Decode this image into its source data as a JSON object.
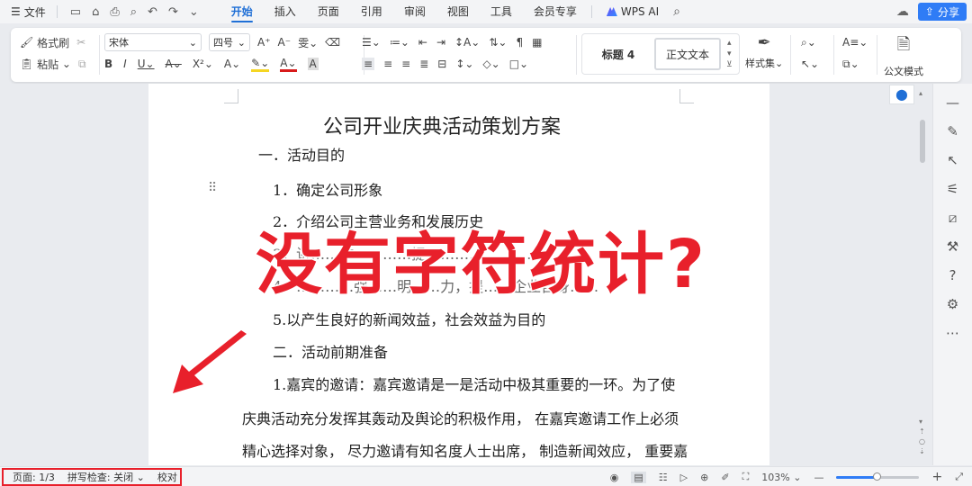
{
  "menubar": {
    "file_label": "文件",
    "tabs": [
      {
        "label": "开始",
        "active": true
      },
      {
        "label": "插入"
      },
      {
        "label": "页面"
      },
      {
        "label": "引用"
      },
      {
        "label": "审阅"
      },
      {
        "label": "视图"
      },
      {
        "label": "工具"
      },
      {
        "label": "会员专享"
      }
    ],
    "wps_ai_label": "WPS AI",
    "share_label": "分享"
  },
  "ribbon": {
    "format_painter": "格式刷",
    "paste": "粘贴",
    "font_name": "宋体",
    "font_size": "四号",
    "styles": {
      "heading4": "标题 4",
      "body_text": "正文文本"
    },
    "style_set": "样式集",
    "official_mode": "公文模式"
  },
  "document": {
    "title": "公司开业庆典活动策划方案",
    "lines": [
      "一．活动目的",
      "1．确定公司形象",
      "2．介绍公司主营业务和发展历史",
      "5.以产生良好的新闻效益，社会效益为目的",
      "二．活动前期准备",
      "1.嘉宾的邀请：嘉宾邀请是一是活动中极其重要的一环。为了使",
      "庆典活动充分发挥其轰动及舆论的积极作用，  在嘉宾邀请工作上必须",
      "精心选择对象，  尽力邀请有知名度人士出席，  制造新闻效应，  重要嘉"
    ],
    "partial_line_a": "3．讲……扩…………提…………………………",
    "partial_line_b": "4．…………强……明……力，提……企业自身……"
  },
  "overlay": {
    "caption": "没有字符统计?"
  },
  "statusbar": {
    "page": "页面: 1/3",
    "spell_check": "拼写检查: 关闭",
    "proofread": "校对",
    "zoom": "103%",
    "zoom_fraction": 0.48
  },
  "colors": {
    "accent": "#1f6fd6",
    "highlight_red": "#e8202b",
    "share_blue": "#2f7cf6"
  }
}
